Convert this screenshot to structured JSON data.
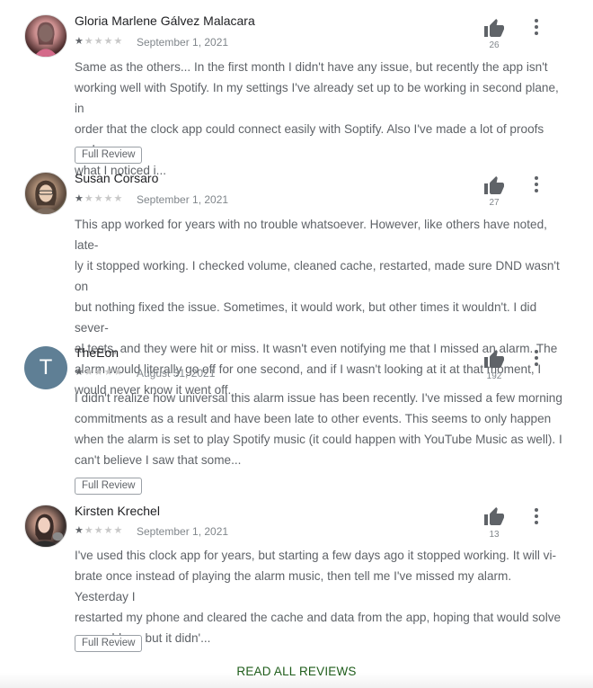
{
  "reviews": [
    {
      "name": "Gloria Marlene Gálvez Malacara",
      "rating": 1,
      "date": "September 1, 2021",
      "likes": "26",
      "avatar": "photo",
      "text": [
        "Same as the others... In the first month I didn't have any issue, but recently the app isn't",
        "working well with Spotify. In my settings I've already set up to be working in second plane, in",
        "order that the clock app could connect easily with Soptify. Also I've made a lot of proofs and",
        "what I noticed i..."
      ],
      "full_review_label": "Full Review"
    },
    {
      "name": "Susan Corsaro",
      "rating": 1,
      "date": "September 1, 2021",
      "likes": "27",
      "avatar": "photo",
      "text": [
        "This app worked for years with no trouble whatsoever. However, like others have noted, late-",
        "ly it stopped working. I checked volume, cleaned cache, restarted, made sure DND wasn't on",
        "but nothing fixed the issue. Sometimes, it would work, but other times it wouldn't. I did sever-",
        "al tests, and they were hit or miss. It wasn't even notifying me that I missed an alarm. The",
        "alarm would literally go off for one second, and if I wasn't looking at it at that moment, I",
        "would never know it went off."
      ]
    },
    {
      "name": "TheEon",
      "rating": 1,
      "date": "August 31, 2021",
      "likes": "192",
      "avatar": "letter",
      "avatar_letter": "T",
      "text": [
        "I didn't realize how universal this alarm issue has been recently. I've missed a few morning",
        "commitments as a result and have been late to other events. This seems to only happen",
        "when the alarm is set to play Spotify music (it could happen with YouTube Music as well). I",
        "can't believe I saw that some..."
      ],
      "full_review_label": "Full Review"
    },
    {
      "name": "Kirsten Krechel",
      "rating": 1,
      "date": "September 1, 2021",
      "likes": "13",
      "avatar": "photo",
      "text": [
        "I've used this clock app for years, but starting a few days ago it stopped working. It will vi-",
        "brate once instead of playing the alarm music, then tell me I've missed my alarm. Yesterday I",
        "restarted my phone and cleared the cache and data from the app, hoping that would solve",
        "my problem, but it didn'..."
      ],
      "full_review_label": "Full Review"
    }
  ],
  "read_all_label": "READ ALL REVIEWS",
  "icons": {
    "like": "thumb-up-icon",
    "more": "more-vertical-icon",
    "star": "star-icon"
  },
  "colors": {
    "accent": "#1e5c1a",
    "text": "#5f6368",
    "name": "#202124",
    "star_filled": "#5f6368",
    "star_empty": "#c8c8c8",
    "avatar_letter_bg": "#5f7f95"
  }
}
